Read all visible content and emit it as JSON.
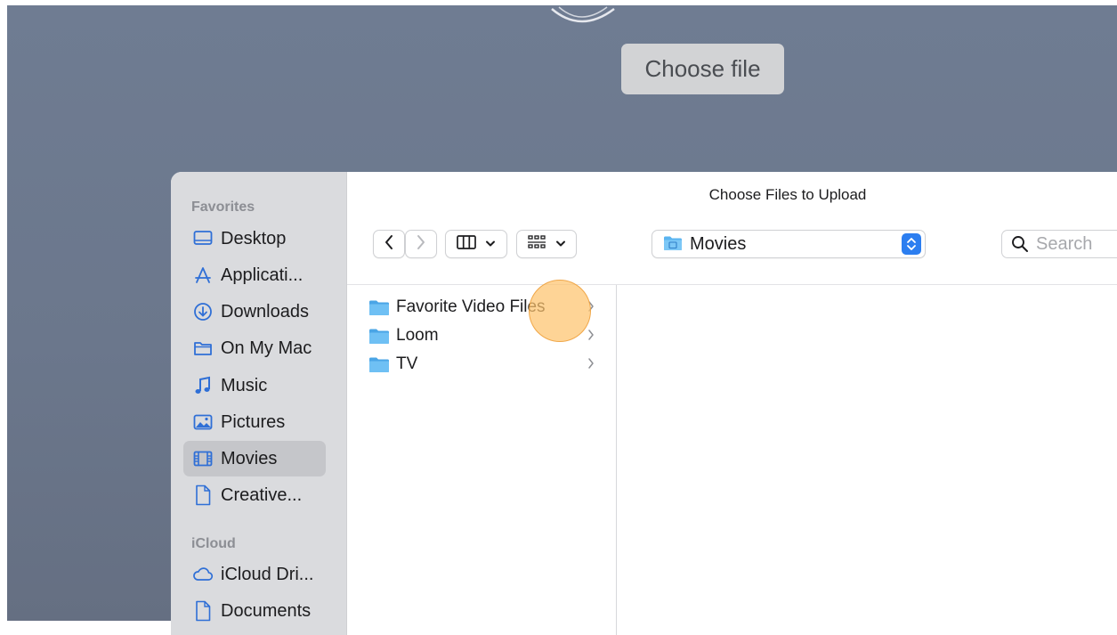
{
  "page": {
    "choose_file_label": "Choose file"
  },
  "dialog": {
    "title": "Choose Files to Upload",
    "location": "Movies",
    "search_placeholder": "Search"
  },
  "sidebar": {
    "favorites_label": "Favorites",
    "favorites": [
      {
        "label": "Desktop",
        "icon": "desktop-icon"
      },
      {
        "label": "Applicati...",
        "icon": "applications-icon"
      },
      {
        "label": "Downloads",
        "icon": "downloads-icon"
      },
      {
        "label": "On My Mac",
        "icon": "folder-icon"
      },
      {
        "label": "Music",
        "icon": "music-icon"
      },
      {
        "label": "Pictures",
        "icon": "pictures-icon"
      },
      {
        "label": "Movies",
        "icon": "movies-icon",
        "selected": true
      },
      {
        "label": "Creative...",
        "icon": "document-icon"
      }
    ],
    "icloud_label": "iCloud",
    "icloud": [
      {
        "label": "iCloud Dri...",
        "icon": "cloud-icon"
      },
      {
        "label": "Documents",
        "icon": "document-icon"
      }
    ]
  },
  "files": [
    {
      "name": "Favorite Video Files",
      "type": "folder"
    },
    {
      "name": "Loom",
      "type": "folder"
    },
    {
      "name": "TV",
      "type": "folder"
    }
  ],
  "colors": {
    "accent": "#2c7ef0",
    "sidebar_icon": "#2f6fd6",
    "folder": "#5ab4f0",
    "click_marker": "#fdc46e"
  }
}
